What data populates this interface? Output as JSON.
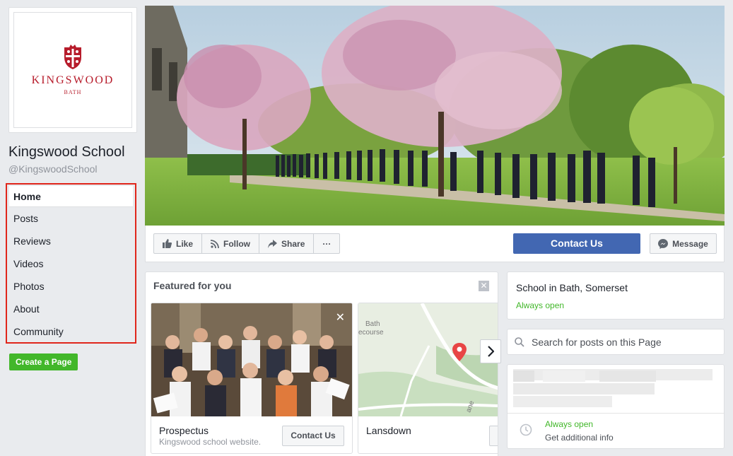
{
  "page": {
    "name": "Kingswood School",
    "handle": "@KingswoodSchool",
    "logo_text": "KINGSWOOD",
    "logo_subtext": "BATH"
  },
  "nav": {
    "items": [
      {
        "label": "Home",
        "active": true
      },
      {
        "label": "Posts"
      },
      {
        "label": "Reviews"
      },
      {
        "label": "Videos"
      },
      {
        "label": "Photos"
      },
      {
        "label": "About"
      },
      {
        "label": "Community"
      }
    ],
    "highlight_color": "#e0261b"
  },
  "create_page_label": "Create a Page",
  "actions": {
    "like": "Like",
    "follow": "Follow",
    "share": "Share",
    "more": "···",
    "contact": "Contact Us",
    "message": "Message"
  },
  "featured": {
    "title": "Featured for you",
    "cards": [
      {
        "title": "Prospectus",
        "subtitle": "Kingswood school website.",
        "button": "Contact Us"
      },
      {
        "title": "Lansdown",
        "map_labels": [
          "Bath",
          "ecourse",
          "ane"
        ]
      }
    ]
  },
  "about": {
    "category": "School in Bath, Somerset",
    "hours_status": "Always open",
    "search_placeholder": "Search for posts on this Page",
    "hours_status_2": "Always open",
    "hours_more": "Get additional info"
  },
  "colors": {
    "primary": "#4267b2",
    "green": "#42b72a",
    "brand_red": "#b71c2b",
    "background": "#e9ebee"
  }
}
